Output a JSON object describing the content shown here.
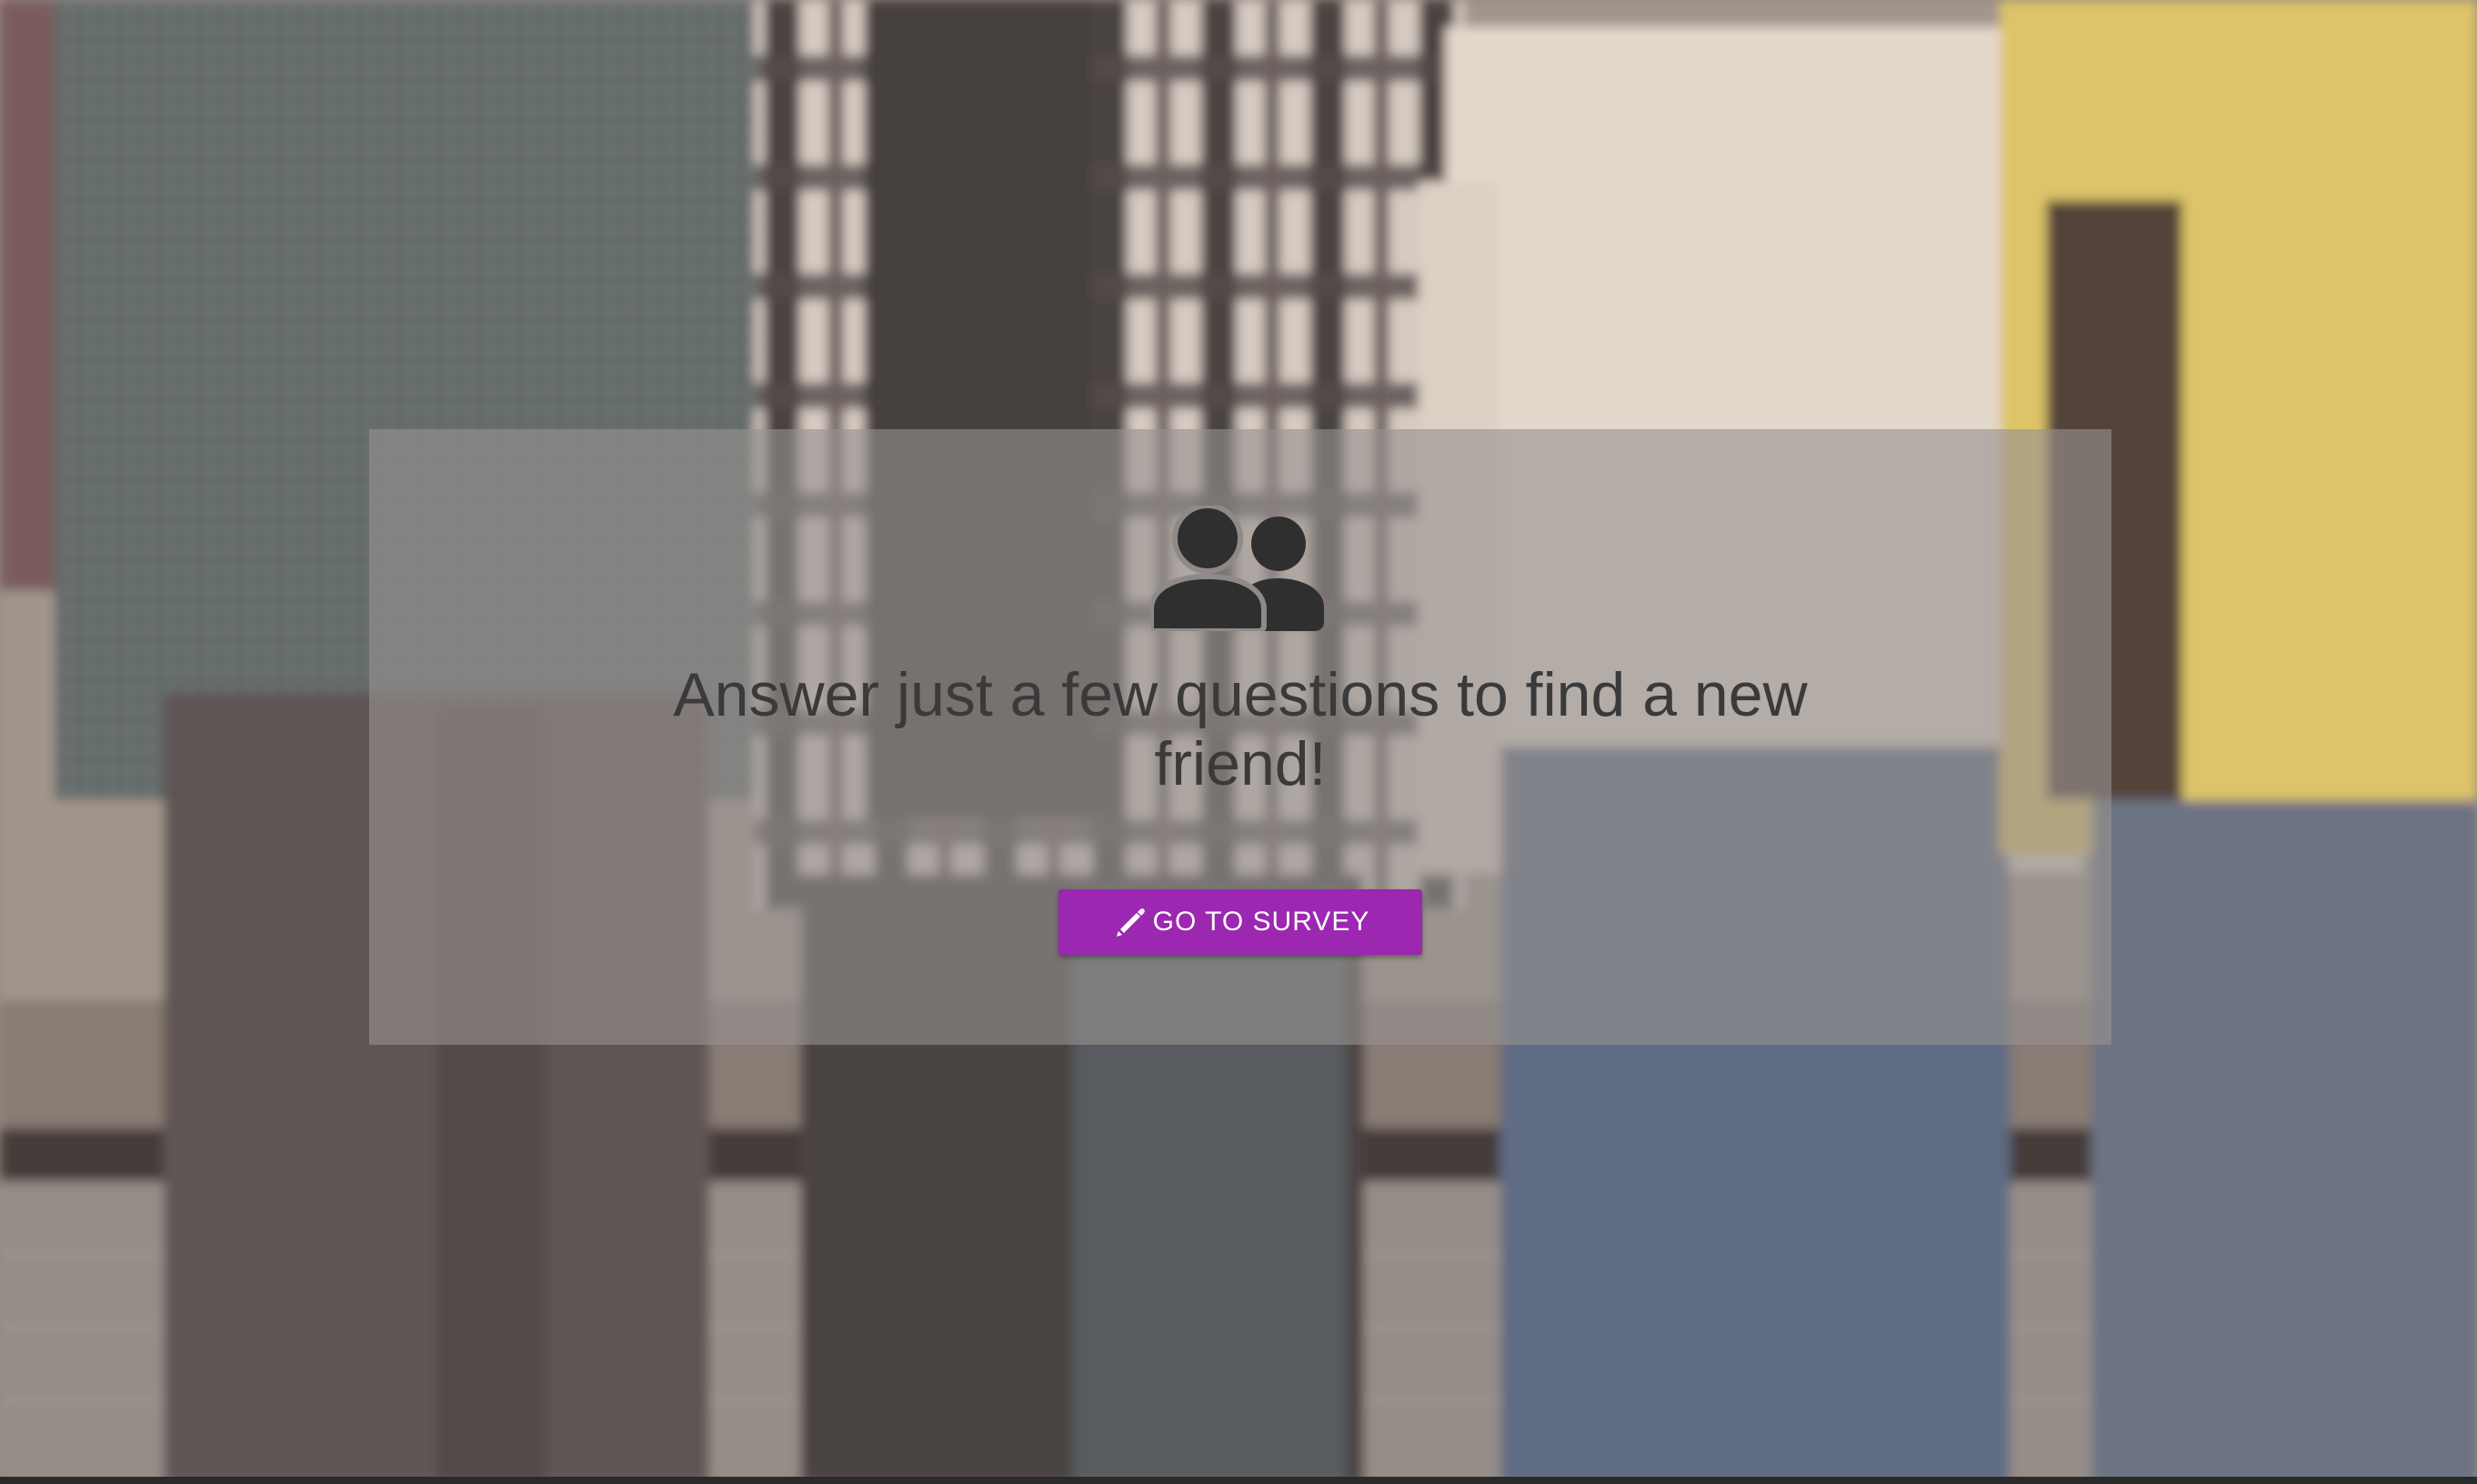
{
  "hero": {
    "icon": "users-icon",
    "headline": "Answer just a few questions to find a new friend!"
  },
  "cta": {
    "icon": "pencil-icon",
    "label": "GO TO SURVEY",
    "color": "#9c27b0"
  },
  "background": {
    "image": "group-of-people-photo"
  }
}
